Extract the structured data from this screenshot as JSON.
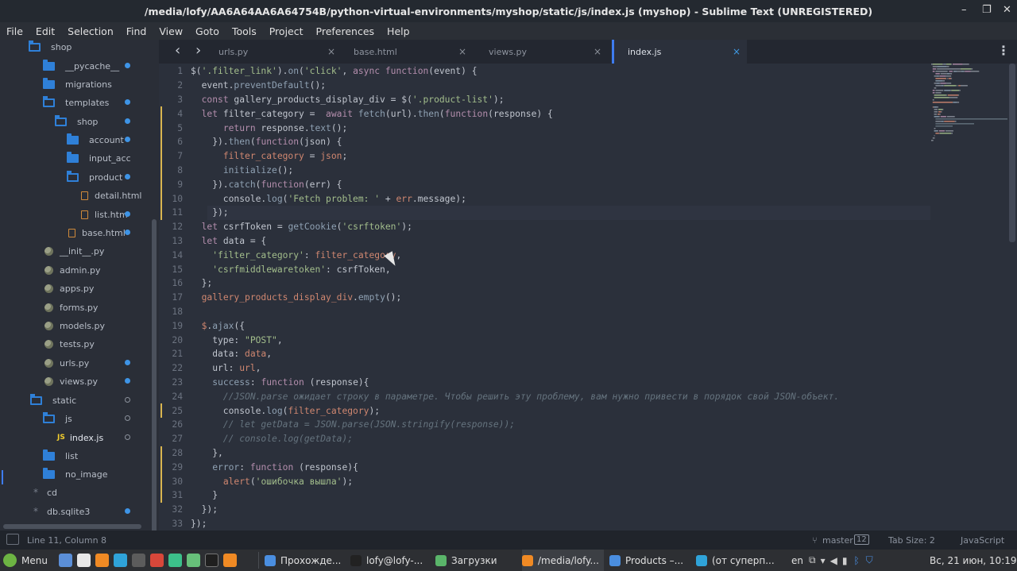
{
  "window": {
    "title": "/media/lofy/AA6A64AA6A64754B/python-virtual-environments/myshop/static/js/index.js (myshop) - Sublime Text (UNREGISTERED)",
    "controls": [
      "–",
      "❐",
      "✕"
    ]
  },
  "menu": [
    "File",
    "Edit",
    "Selection",
    "Find",
    "View",
    "Goto",
    "Tools",
    "Project",
    "Preferences",
    "Help"
  ],
  "sidebar": {
    "items": [
      {
        "label": "shop",
        "icon": "folder-open-icon",
        "dot": ""
      },
      {
        "label": "__pycache__",
        "icon": "folder-icon",
        "dot": "full"
      },
      {
        "label": "migrations",
        "icon": "folder-icon",
        "dot": ""
      },
      {
        "label": "templates",
        "icon": "folder-open-icon",
        "dot": "full"
      },
      {
        "label": "shop",
        "icon": "folder-open-icon",
        "dot": "full"
      },
      {
        "label": "account",
        "icon": "folder-icon",
        "dot": "full"
      },
      {
        "label": "input_acc",
        "icon": "folder-icon",
        "dot": ""
      },
      {
        "label": "product",
        "icon": "folder-open-icon",
        "dot": "full"
      },
      {
        "label": "detail.html",
        "icon": "html-file-icon",
        "dot": ""
      },
      {
        "label": "list.htm",
        "icon": "html-file-icon",
        "dot": "full"
      },
      {
        "label": "base.html",
        "icon": "html-file-icon",
        "dot": "full"
      },
      {
        "label": "__init__.py",
        "icon": "python-file-icon",
        "dot": ""
      },
      {
        "label": "admin.py",
        "icon": "python-file-icon",
        "dot": ""
      },
      {
        "label": "apps.py",
        "icon": "python-file-icon",
        "dot": ""
      },
      {
        "label": "forms.py",
        "icon": "python-file-icon",
        "dot": ""
      },
      {
        "label": "models.py",
        "icon": "python-file-icon",
        "dot": ""
      },
      {
        "label": "tests.py",
        "icon": "python-file-icon",
        "dot": ""
      },
      {
        "label": "urls.py",
        "icon": "python-file-icon",
        "dot": "full"
      },
      {
        "label": "views.py",
        "icon": "python-file-icon",
        "dot": "full"
      },
      {
        "label": "static",
        "icon": "folder-open-icon",
        "dot": "hollow"
      },
      {
        "label": "js",
        "icon": "folder-open-icon",
        "dot": "hollow"
      },
      {
        "label": "index.js",
        "icon": "js-file-icon",
        "dot": "hollow"
      },
      {
        "label": "list",
        "icon": "folder-icon",
        "dot": ""
      },
      {
        "label": "no_image",
        "icon": "folder-icon",
        "dot": ""
      },
      {
        "label": "cd",
        "icon": "star-file-icon",
        "dot": ""
      },
      {
        "label": "db.sqlite3",
        "icon": "star-file-icon",
        "dot": "full"
      }
    ]
  },
  "tabs": [
    {
      "label": "urls.py",
      "active": false
    },
    {
      "label": "base.html",
      "active": false
    },
    {
      "label": "views.py",
      "active": false
    },
    {
      "label": "index.js",
      "active": true
    }
  ],
  "editor": {
    "current_line": 11,
    "lines": [
      [
        [
          "pl",
          "$("
        ],
        [
          "str",
          "'.filter_link'"
        ],
        [
          "pl",
          ")."
        ],
        [
          "fn",
          "on"
        ],
        [
          "pl",
          "("
        ],
        [
          "str",
          "'click'"
        ],
        [
          "pl",
          ", "
        ],
        [
          "kw",
          "async function"
        ],
        [
          "pl",
          "(event) {"
        ]
      ],
      [
        [
          "pl",
          "  event."
        ],
        [
          "fn",
          "preventDefault"
        ],
        [
          "pl",
          "();"
        ]
      ],
      [
        [
          "pl",
          "  "
        ],
        [
          "kw",
          "const"
        ],
        [
          "pl",
          " gallery_products_display_div = $("
        ],
        [
          "str",
          "'.product-list'"
        ],
        [
          "pl",
          ");"
        ]
      ],
      [
        [
          "pl",
          "  "
        ],
        [
          "kw",
          "let"
        ],
        [
          "pl",
          " filter_category = "
        ],
        [
          "kw",
          " await"
        ],
        [
          "pl",
          " "
        ],
        [
          "fn",
          "fetch"
        ],
        [
          "pl",
          "(url)."
        ],
        [
          "fn",
          "then"
        ],
        [
          "pl",
          "("
        ],
        [
          "kw",
          "function"
        ],
        [
          "pl",
          "(response) {"
        ]
      ],
      [
        [
          "pl",
          "      "
        ],
        [
          "kw",
          "return"
        ],
        [
          "pl",
          " response."
        ],
        [
          "fn",
          "text"
        ],
        [
          "pl",
          "();"
        ]
      ],
      [
        [
          "pl",
          "    })."
        ],
        [
          "fn",
          "then"
        ],
        [
          "pl",
          "("
        ],
        [
          "kw",
          "function"
        ],
        [
          "pl",
          "(json) {"
        ]
      ],
      [
        [
          "pl",
          "      "
        ],
        [
          "var",
          "filter_category"
        ],
        [
          "pl",
          " = "
        ],
        [
          "var",
          "json"
        ],
        [
          "pl",
          ";"
        ]
      ],
      [
        [
          "pl",
          "      "
        ],
        [
          "fn",
          "initialize"
        ],
        [
          "pl",
          "();"
        ]
      ],
      [
        [
          "pl",
          "    })."
        ],
        [
          "fn",
          "catch"
        ],
        [
          "pl",
          "("
        ],
        [
          "kw",
          "function"
        ],
        [
          "pl",
          "(err) {"
        ]
      ],
      [
        [
          "pl",
          "      console."
        ],
        [
          "fn",
          "log"
        ],
        [
          "pl",
          "("
        ],
        [
          "str",
          "'Fetch problem: '"
        ],
        [
          "pl",
          " + "
        ],
        [
          "var",
          "err"
        ],
        [
          "pl",
          ".message);"
        ]
      ],
      [
        [
          "pl",
          "    });"
        ]
      ],
      [
        [
          "pl",
          "  "
        ],
        [
          "kw",
          "let"
        ],
        [
          "pl",
          " csrfToken = "
        ],
        [
          "fn",
          "getCookie"
        ],
        [
          "pl",
          "("
        ],
        [
          "str",
          "'csrftoken'"
        ],
        [
          "pl",
          ");"
        ]
      ],
      [
        [
          "pl",
          "  "
        ],
        [
          "kw",
          "let"
        ],
        [
          "pl",
          " data = {"
        ]
      ],
      [
        [
          "pl",
          "    "
        ],
        [
          "str",
          "'filter_category'"
        ],
        [
          "pl",
          ": "
        ],
        [
          "var",
          "filter_category"
        ],
        [
          "pl",
          ","
        ]
      ],
      [
        [
          "pl",
          "    "
        ],
        [
          "str",
          "'csrfmiddlewaretoken'"
        ],
        [
          "pl",
          ": csrfToken,"
        ]
      ],
      [
        [
          "pl",
          "  };"
        ]
      ],
      [
        [
          "pl",
          "  "
        ],
        [
          "var",
          "gallery_products_display_div"
        ],
        [
          "pl",
          "."
        ],
        [
          "fn",
          "empty"
        ],
        [
          "pl",
          "();"
        ]
      ],
      [
        [
          "pl",
          ""
        ]
      ],
      [
        [
          "pl",
          "  "
        ],
        [
          "var",
          "$"
        ],
        [
          "pl",
          "."
        ],
        [
          "fn",
          "ajax"
        ],
        [
          "pl",
          "({"
        ]
      ],
      [
        [
          "pl",
          "    type: "
        ],
        [
          "str",
          "\"POST\""
        ],
        [
          "pl",
          ","
        ]
      ],
      [
        [
          "pl",
          "    data: "
        ],
        [
          "var",
          "data"
        ],
        [
          "pl",
          ","
        ]
      ],
      [
        [
          "pl",
          "    url: "
        ],
        [
          "var",
          "url"
        ],
        [
          "pl",
          ","
        ]
      ],
      [
        [
          "pl",
          "    "
        ],
        [
          "fn",
          "success"
        ],
        [
          "pl",
          ": "
        ],
        [
          "kw",
          "function"
        ],
        [
          "pl",
          " (response){"
        ]
      ],
      [
        [
          "cm",
          "      //JSON.parse ожидает строку в параметре. Чтобы решить эту проблему, вам нужно привести в порядок свой JSON-объект."
        ]
      ],
      [
        [
          "pl",
          "      console."
        ],
        [
          "fn",
          "log"
        ],
        [
          "pl",
          "("
        ],
        [
          "var",
          "filter_category"
        ],
        [
          "pl",
          ");"
        ]
      ],
      [
        [
          "cm",
          "      // let getData = JSON.parse(JSON.stringify(response));"
        ]
      ],
      [
        [
          "cm",
          "      // console.log(getData);"
        ]
      ],
      [
        [
          "pl",
          "    },"
        ]
      ],
      [
        [
          "pl",
          "    "
        ],
        [
          "fn",
          "error"
        ],
        [
          "pl",
          ": "
        ],
        [
          "kw",
          "function"
        ],
        [
          "pl",
          " (response){"
        ]
      ],
      [
        [
          "pl",
          "      "
        ],
        [
          "var",
          "alert"
        ],
        [
          "pl",
          "("
        ],
        [
          "str",
          "'ошибочка вышла'"
        ],
        [
          "pl",
          ");"
        ]
      ],
      [
        [
          "pl",
          "    }"
        ]
      ],
      [
        [
          "pl",
          "  });"
        ]
      ],
      [
        [
          "pl",
          "});"
        ]
      ]
    ],
    "modified_lines": [
      4,
      5,
      6,
      7,
      8,
      9,
      10,
      11,
      25,
      28,
      29,
      30,
      31
    ]
  },
  "status": {
    "position": "Line 11, Column 8",
    "branch": "master",
    "branch_count": "12",
    "tab_size": "Tab Size: 2",
    "syntax": "JavaScript"
  },
  "taskbar": {
    "menu_label": "Menu",
    "windows": [
      "Прохожде...",
      "lofy@lofy-...",
      "Загрузки",
      "/media/lofy...",
      "Products –...",
      "(от суперп..."
    ],
    "lang": "en",
    "clock": "Вс, 21 июн, 10:19"
  },
  "colors": {
    "editor_bg": "#2b303b",
    "accent_blue": "#3e7cf0",
    "modified_marker": "#d9b550"
  }
}
